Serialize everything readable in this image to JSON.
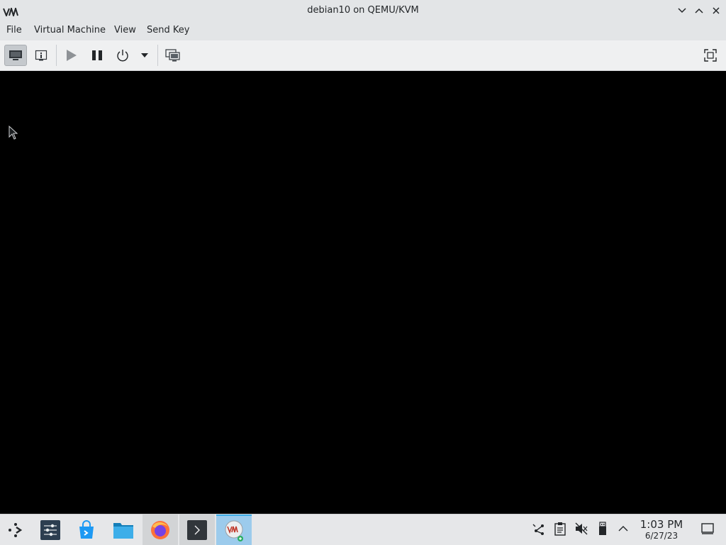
{
  "window": {
    "title": "debian10 on QEMU/KVM",
    "logo": "VM"
  },
  "window_controls": [
    {
      "name": "minimize-button",
      "icon": "chevron-down-icon"
    },
    {
      "name": "maximize-button",
      "icon": "chevron-up-icon"
    },
    {
      "name": "close-button",
      "icon": "close-icon"
    }
  ],
  "menubar": {
    "items": [
      "File",
      "Virtual Machine",
      "View",
      "Send Key"
    ]
  },
  "toolbar": {
    "buttons": [
      {
        "name": "console-view-button",
        "icon": "monitor-icon",
        "active": true
      },
      {
        "name": "details-view-button",
        "icon": "info-icon",
        "active": false
      },
      {
        "name": "run-button",
        "icon": "play-icon",
        "active": false
      },
      {
        "name": "pause-button",
        "icon": "pause-icon",
        "active": false
      },
      {
        "name": "shutdown-button",
        "icon": "power-icon",
        "active": false
      },
      {
        "name": "shutdown-menu-button",
        "icon": "dropdown-arrow-icon",
        "active": false
      },
      {
        "name": "snapshots-button",
        "icon": "snapshots-icon",
        "active": false
      },
      {
        "name": "fullscreen-button",
        "icon": "fullscreen-icon",
        "active": false
      }
    ]
  },
  "taskbar": {
    "launcher_icon": "app-launcher-icon",
    "tasks": [
      {
        "name": "system-settings",
        "icon": "settings-sliders-icon",
        "state": "pinned"
      },
      {
        "name": "discover",
        "icon": "store-bag-icon",
        "state": "pinned"
      },
      {
        "name": "file-manager",
        "icon": "folder-icon",
        "state": "pinned"
      },
      {
        "name": "firefox",
        "icon": "firefox-icon",
        "state": "open"
      },
      {
        "name": "terminal",
        "icon": "terminal-icon",
        "state": "open"
      },
      {
        "name": "virt-manager",
        "icon": "vm-icon",
        "state": "active"
      }
    ],
    "tray": [
      "network-icon",
      "clipboard-icon",
      "volume-muted-icon",
      "usb-device-icon",
      "tray-expand-icon"
    ],
    "clock": {
      "time": "1:03 PM",
      "date": "6/27/23"
    },
    "show_desktop_icon": "show-desktop-icon"
  },
  "colors": {
    "titlebar": "#e3e5e7",
    "toolbar": "#eff0f1",
    "viewport": "#000000",
    "taskbar": "#e6e7e9",
    "active_task": "#9ccbec",
    "accent": "#3daee9"
  }
}
